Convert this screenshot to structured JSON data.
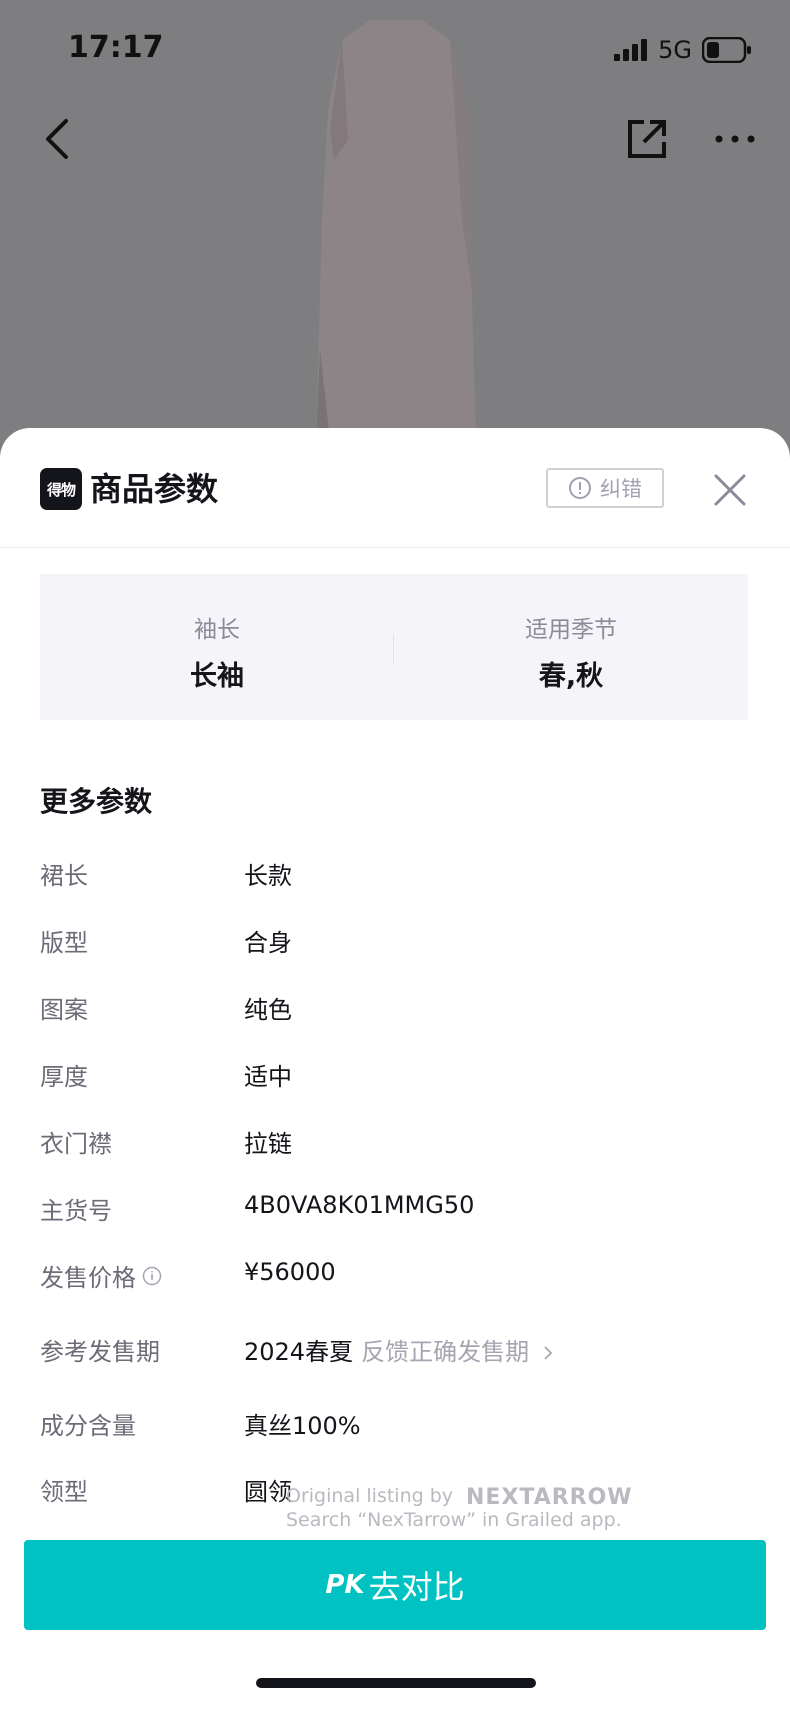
{
  "status_bar": {
    "time": "17:17",
    "network": "5G"
  },
  "sheet": {
    "logo_text": "得物",
    "title": "商品参数",
    "report_label": "纠错"
  },
  "key_params": [
    {
      "label": "袖长",
      "value": "长袖"
    },
    {
      "label": "适用季节",
      "value": "春,秋"
    }
  ],
  "more_params": {
    "title": "更多参数",
    "rows": [
      {
        "label": "裙长",
        "value": "长款"
      },
      {
        "label": "版型",
        "value": "合身"
      },
      {
        "label": "图案",
        "value": "纯色"
      },
      {
        "label": "厚度",
        "value": "适中"
      },
      {
        "label": "衣门襟",
        "value": "拉链"
      },
      {
        "label": "主货号",
        "value": "4B0VA8K01MMG50"
      },
      {
        "label": "发售价格",
        "value": "¥56000"
      },
      {
        "label": "参考发售期",
        "value": "2024春夏",
        "link": "反馈正确发售期"
      },
      {
        "label": "成分含量",
        "value": "真丝100%"
      },
      {
        "label": "领型",
        "value": "圆领"
      }
    ]
  },
  "watermark": {
    "line1": "Original listing by",
    "brand": "NEXTARROW",
    "line2": "Search “NexTarrow” in Grailed app."
  },
  "compare_button": {
    "prefix": "PK",
    "label": "去对比"
  },
  "colors": {
    "accent": "#01c2c3",
    "overlay": "#7e7e80"
  }
}
